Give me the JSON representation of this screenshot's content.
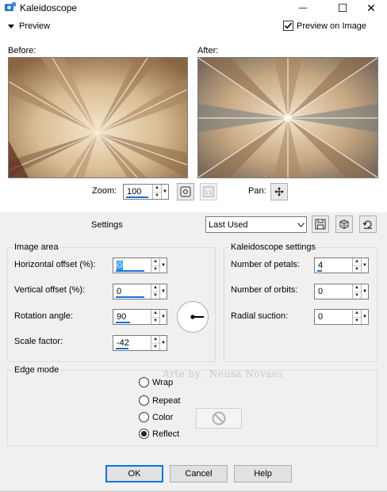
{
  "window": {
    "title": "Kaleidoscope",
    "minimize_glyph": "—",
    "maximize_glyph": "☐",
    "close_glyph": "✕"
  },
  "preview": {
    "toggle_label": "Preview",
    "preview_on_image_label": "Preview on Image",
    "preview_on_image_checked": true,
    "before_label": "Before:",
    "after_label": "After:"
  },
  "zoom": {
    "label": "Zoom:",
    "value": "100",
    "pan_label": "Pan:"
  },
  "settings": {
    "label": "Settings",
    "preset_value": "Last Used"
  },
  "image_area": {
    "title": "Image area",
    "horizontal_offset_label": "Horizontal offset (%):",
    "horizontal_offset_value": "0",
    "vertical_offset_label": "Vertical offset (%):",
    "vertical_offset_value": "0",
    "rotation_angle_label": "Rotation angle:",
    "rotation_angle_value": "90",
    "scale_factor_label": "Scale factor:",
    "scale_factor_value": "-42"
  },
  "kaleidoscope_settings": {
    "title": "Kaleidoscope settings",
    "petals_label": "Number of petals:",
    "petals_value": "4",
    "orbits_label": "Number of orbits:",
    "orbits_value": "0",
    "radial_suction_label": "Radial suction:",
    "radial_suction_value": "0"
  },
  "edge_mode": {
    "title": "Edge mode",
    "options": [
      "Wrap",
      "Repeat",
      "Color",
      "Reflect"
    ],
    "selected": "Reflect"
  },
  "watermark": "Arte by _Neusa Novaes",
  "buttons": {
    "ok": "OK",
    "cancel": "Cancel",
    "help": "Help"
  },
  "colors": {
    "accent": "#1e6fd0",
    "dialog_bg": "#f0f0f0",
    "default_button_border": "#0078d7"
  }
}
